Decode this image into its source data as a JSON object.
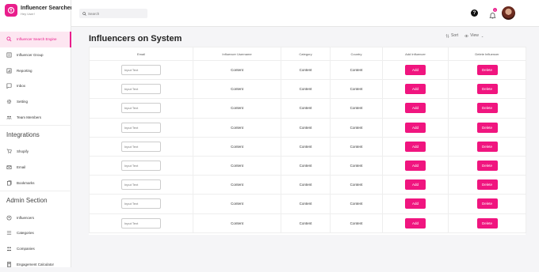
{
  "brand": {
    "title": "Influencer Searcher",
    "subtitle": "Hey User!"
  },
  "sidebar": {
    "items": [
      {
        "label": "Influencer Search Engine",
        "icon": "search-icon",
        "active": true
      },
      {
        "label": "Influencer Group",
        "icon": "group-icon"
      },
      {
        "label": "Reporting",
        "icon": "report-icon"
      },
      {
        "label": "Inbox",
        "icon": "inbox-icon"
      },
      {
        "label": "Setting",
        "icon": "gear-icon"
      },
      {
        "label": "Team Members",
        "icon": "team-icon"
      }
    ],
    "integrations_title": "Integrations",
    "integrations": [
      {
        "label": "Shopify",
        "icon": "cart-icon"
      },
      {
        "label": "Email",
        "icon": "mail-icon"
      },
      {
        "label": "Bookmarks",
        "icon": "bookmark-icon"
      }
    ],
    "admin_title": "Admin Section",
    "admin": [
      {
        "label": "Influencers",
        "icon": "influencer-icon"
      },
      {
        "label": "Categories",
        "icon": "list-icon"
      },
      {
        "label": "Companies",
        "icon": "building-icon"
      },
      {
        "label": "Engagement Calculator",
        "icon": "calculator-icon"
      }
    ]
  },
  "topbar": {
    "search_placeholder": "Search",
    "help": "?",
    "notifications": "1"
  },
  "main": {
    "title": "Influencers on System",
    "sort_label": "Sort",
    "view_label": "View"
  },
  "table": {
    "headers": [
      "Email",
      "Influencer Username",
      "Category",
      "Country",
      "Add Influencer",
      "Delete Influencer"
    ],
    "input_placeholder": "Input Text",
    "add_label": "Add",
    "delete_label": "Delete",
    "rows": [
      {
        "username": "Content",
        "category": "Content",
        "country": "Content"
      },
      {
        "username": "Content",
        "category": "Content",
        "country": "Content"
      },
      {
        "username": "Content",
        "category": "Content",
        "country": "Content"
      },
      {
        "username": "Content",
        "category": "Content",
        "country": "Content"
      },
      {
        "username": "Content",
        "category": "Content",
        "country": "Content"
      },
      {
        "username": "Content",
        "category": "Content",
        "country": "Content"
      },
      {
        "username": "Content",
        "category": "Content",
        "country": "Content"
      },
      {
        "username": "Content",
        "category": "Content",
        "country": "Content"
      },
      {
        "username": "Content",
        "category": "Content",
        "country": "Content"
      }
    ]
  },
  "colors": {
    "accent": "#f0157f",
    "active_bg": "#fde6f1"
  }
}
